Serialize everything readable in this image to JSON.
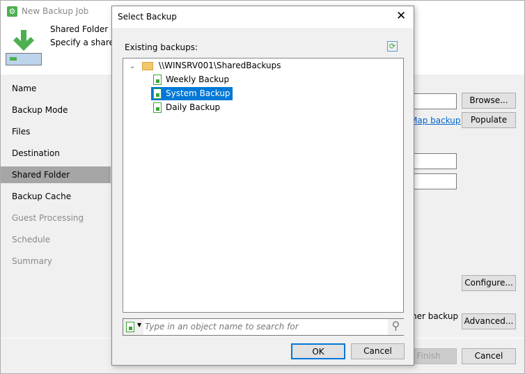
{
  "main_window": {
    "title": "New Backup Job",
    "header_title": "Shared Folder",
    "header_desc": "Specify a shared f",
    "nav": [
      {
        "label": "Name",
        "state": "normal"
      },
      {
        "label": "Backup Mode",
        "state": "normal"
      },
      {
        "label": "Files",
        "state": "normal"
      },
      {
        "label": "Destination",
        "state": "normal"
      },
      {
        "label": "Shared Folder",
        "state": "selected"
      },
      {
        "label": "Backup Cache",
        "state": "normal"
      },
      {
        "label": "Guest Processing",
        "state": "disabled"
      },
      {
        "label": "Schedule",
        "state": "disabled"
      },
      {
        "label": "Summary",
        "state": "disabled"
      }
    ],
    "browse": "Browse...",
    "map_backup": "Map backup",
    "populate": "Populate",
    "configure": "Configure...",
    "other_backup_text": "her backup",
    "advanced": "Advanced...",
    "finish": "Finish",
    "cancel": "Cancel"
  },
  "dialog": {
    "title": "Select Backup",
    "existing_label": "Existing backups:",
    "tree": {
      "root": "\\\\WINSRV001\\SharedBackups",
      "items": [
        {
          "label": "Weekly Backup",
          "selected": false
        },
        {
          "label": "System Backup",
          "selected": true
        },
        {
          "label": "Daily Backup",
          "selected": false
        }
      ]
    },
    "search_placeholder": "Type in an object name to search for",
    "ok": "OK",
    "cancel": "Cancel"
  },
  "colors": {
    "accent": "#0078d7",
    "green": "#3aa33a",
    "link": "#0066cc"
  }
}
